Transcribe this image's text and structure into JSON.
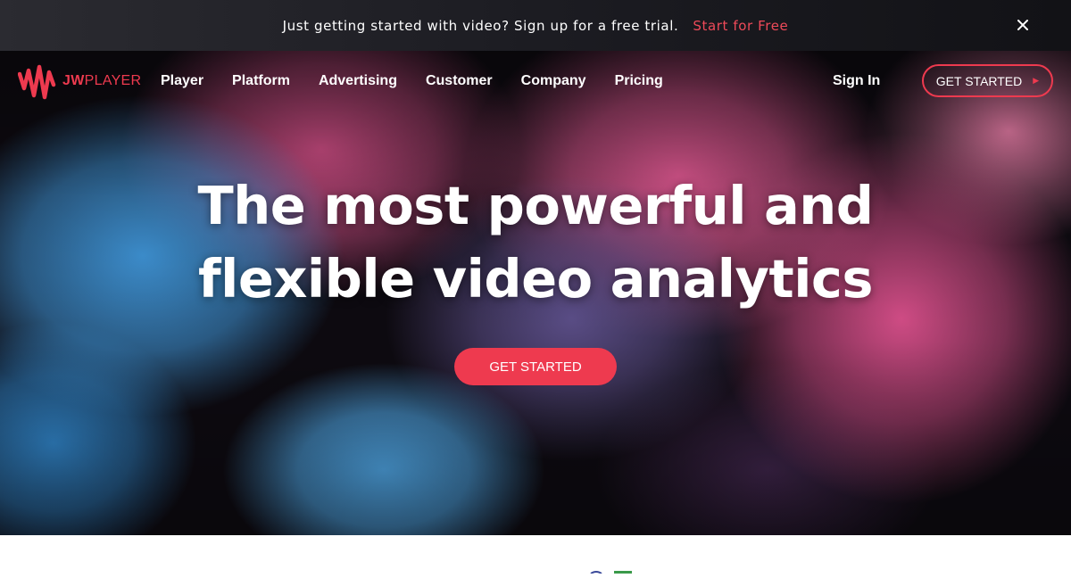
{
  "announcement": {
    "message": "Just getting started with video? Sign up for a free trial.",
    "cta_label": "Start for Free",
    "close_icon": "close-icon"
  },
  "logo": {
    "icon": "jw-wave-icon",
    "word_bold": "JW",
    "word_rest": "PLAYER"
  },
  "nav": {
    "items": [
      {
        "label": "Player"
      },
      {
        "label": "Platform"
      },
      {
        "label": "Advertising"
      },
      {
        "label": "Customer"
      },
      {
        "label": "Company"
      },
      {
        "label": "Pricing"
      }
    ],
    "sign_in": "Sign In",
    "cta_label": "GET STARTED",
    "cta_icon": "play-arrow-icon"
  },
  "hero": {
    "headline_line1": "The most powerful and",
    "headline_line2": "flexible video analytics",
    "cta_label": "GET STARTED"
  },
  "colors": {
    "brand_red": "#ee3a4f",
    "announce_bg": "#1c1c22",
    "hero_dark": "#0d0a10"
  }
}
